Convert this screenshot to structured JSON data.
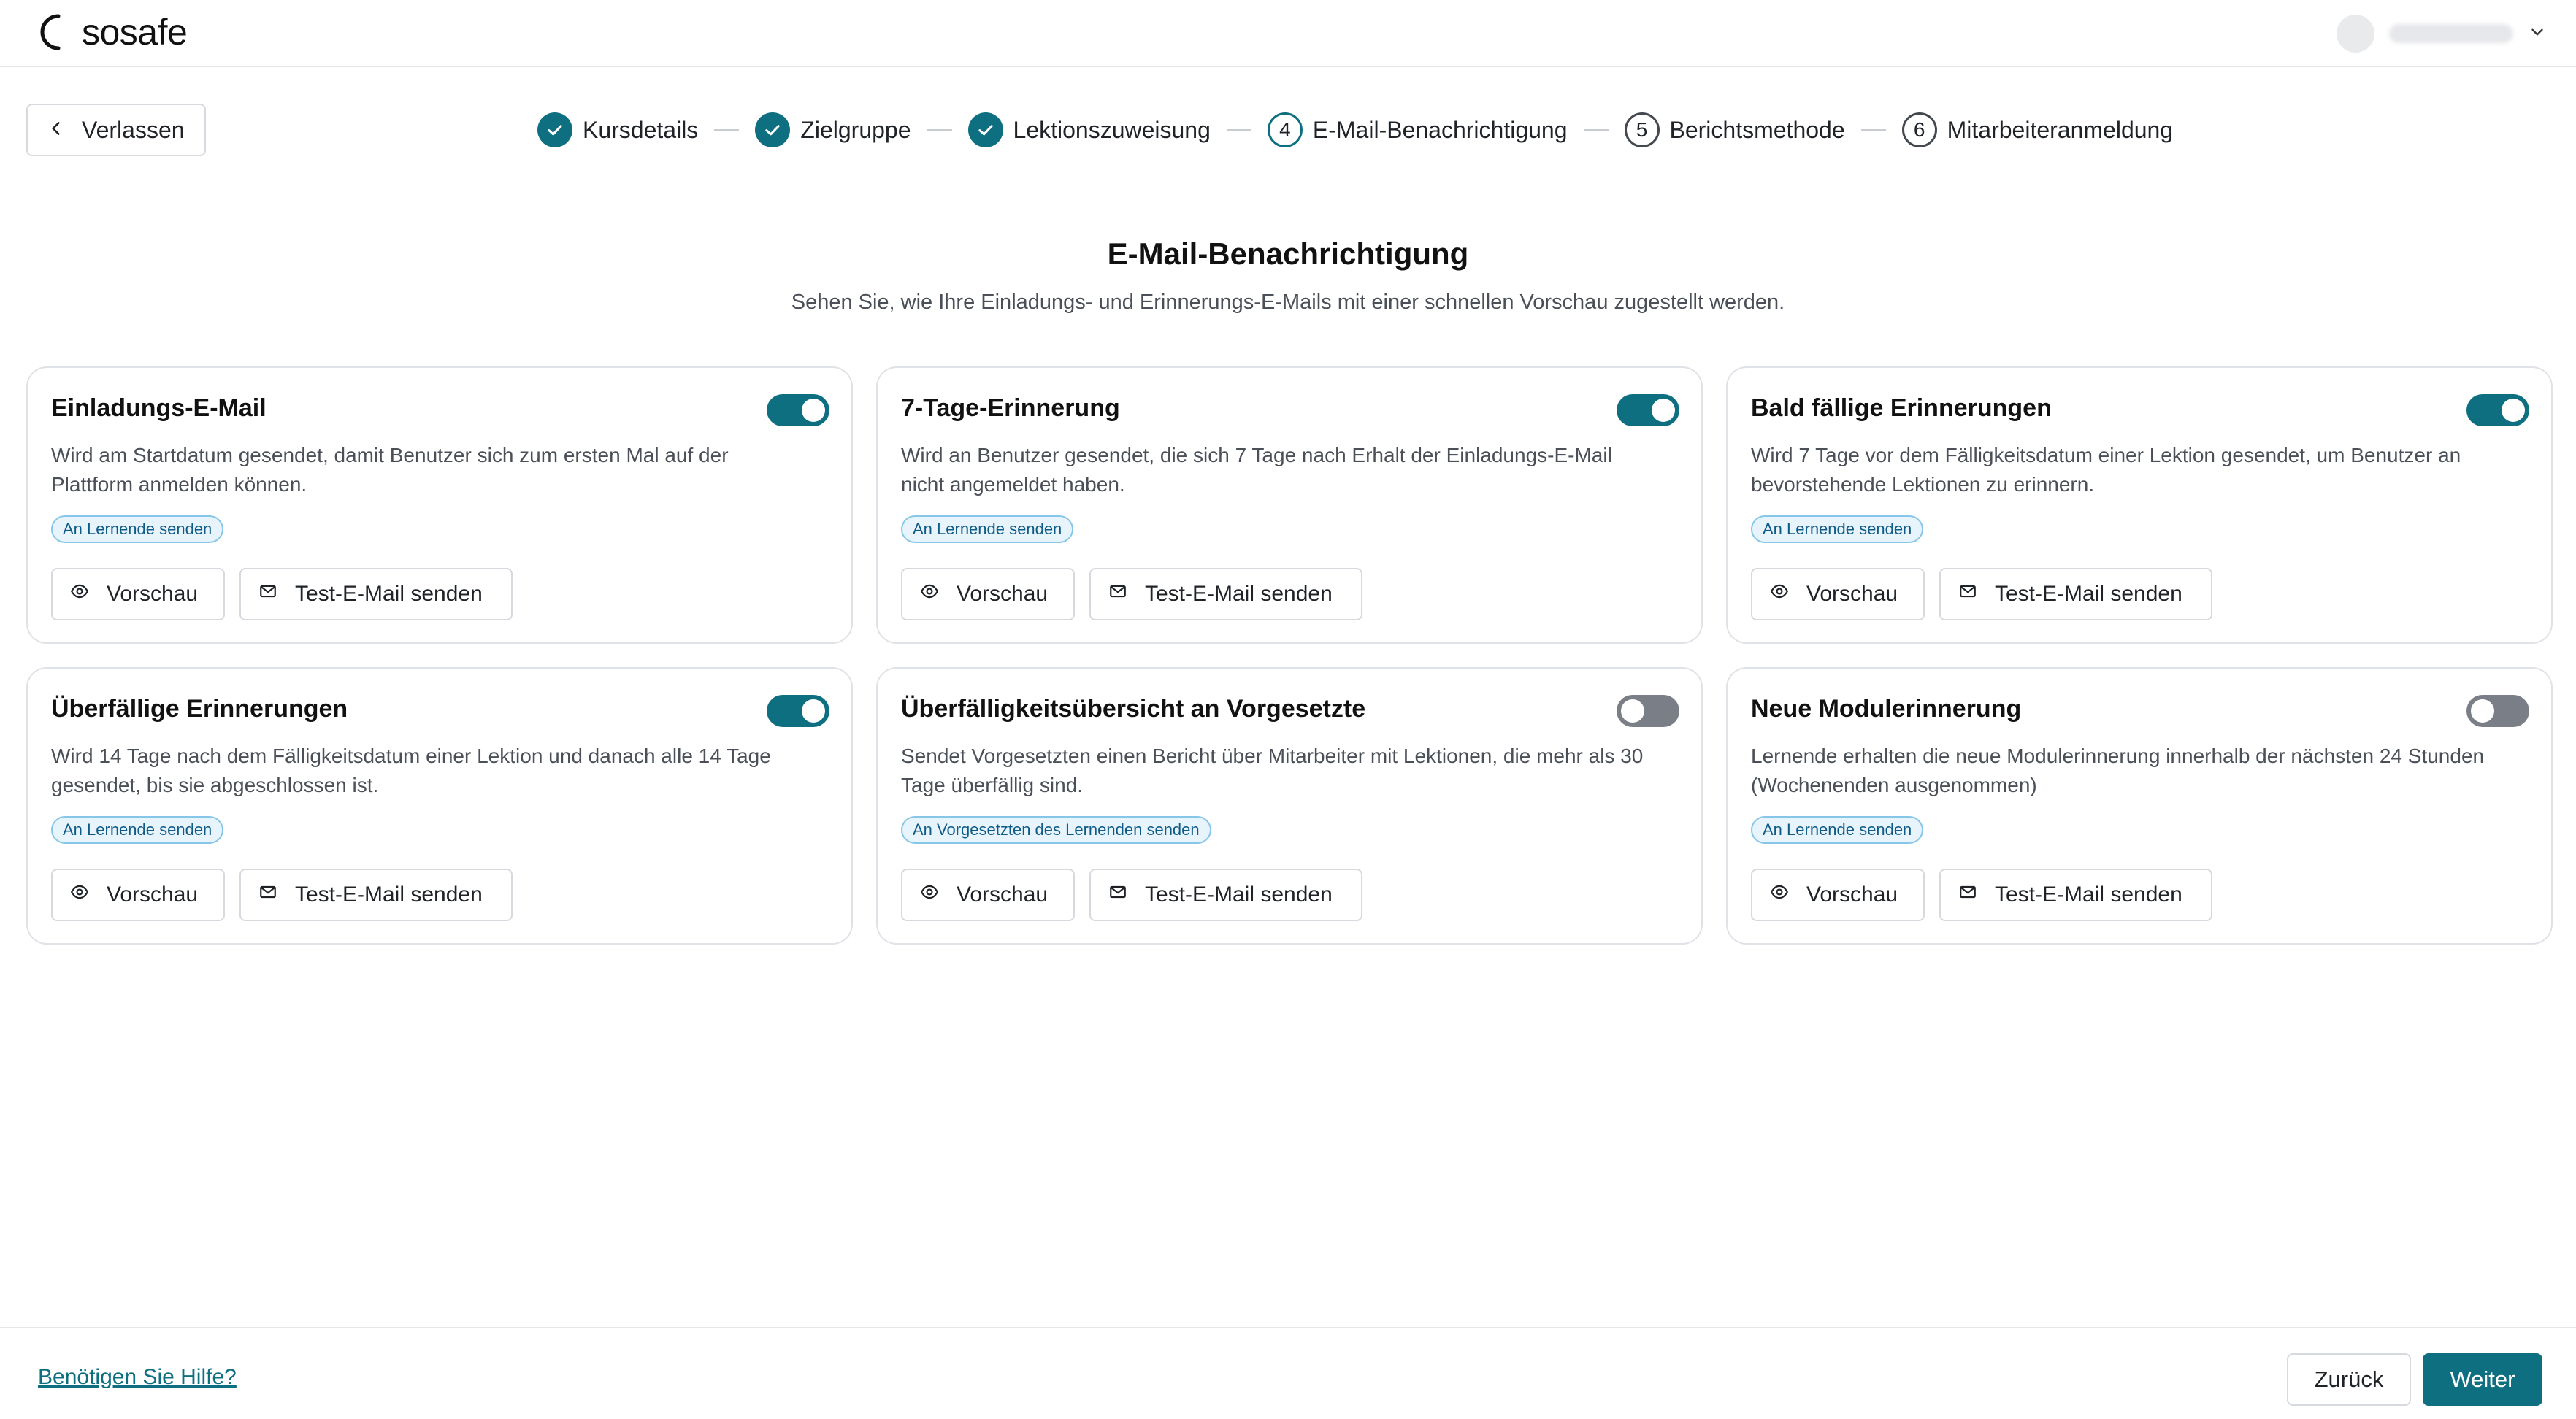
{
  "brand": {
    "name": "sosafe",
    "accent": "#0e6f80"
  },
  "header": {
    "user_menu_icon": "chevron-down-icon"
  },
  "nav": {
    "leave_label": "Verlassen"
  },
  "stepper": {
    "steps": [
      {
        "number": "1",
        "label": "Kursdetails",
        "status": "done"
      },
      {
        "number": "2",
        "label": "Zielgruppe",
        "status": "done"
      },
      {
        "number": "3",
        "label": "Lektionszuweisung",
        "status": "done"
      },
      {
        "number": "4",
        "label": "E-Mail-Benachrichtigung",
        "status": "current"
      },
      {
        "number": "5",
        "label": "Berichtsmethode",
        "status": "todo"
      },
      {
        "number": "6",
        "label": "Mitarbeiteranmeldung",
        "status": "todo"
      }
    ]
  },
  "page": {
    "title": "E-Mail-Benachrichtigung",
    "subtitle": "Sehen Sie, wie Ihre Einladungs- und Erinnerungs-E-Mails mit einer schnellen Vorschau zugestellt werden."
  },
  "buttons": {
    "preview": "Vorschau",
    "test": "Test-E-Mail senden"
  },
  "cards": [
    {
      "title": "Einladungs-E-Mail",
      "enabled": true,
      "description": "Wird am Startdatum gesendet, damit Benutzer sich zum ersten Mal auf der Plattform anmelden können.",
      "badge": "An Lernende senden"
    },
    {
      "title": "7-Tage-Erinnerung",
      "enabled": true,
      "description": "Wird an Benutzer gesendet, die sich 7 Tage nach Erhalt der Einladungs-E-Mail nicht angemeldet haben.",
      "badge": "An Lernende senden"
    },
    {
      "title": "Bald fällige Erinnerungen",
      "enabled": true,
      "description": "Wird 7 Tage vor dem Fälligkeitsdatum einer Lektion gesendet, um Benutzer an bevorstehende Lektionen zu erinnern.",
      "badge": "An Lernende senden"
    },
    {
      "title": "Überfällige Erinnerungen",
      "enabled": true,
      "description": "Wird 14 Tage nach dem Fälligkeitsdatum einer Lektion und danach alle 14 Tage gesendet, bis sie abgeschlossen ist.",
      "badge": "An Lernende senden"
    },
    {
      "title": "Überfälligkeitsübersicht an Vorgesetzte",
      "enabled": false,
      "description": "Sendet Vorgesetzten einen Bericht über Mitarbeiter mit Lektionen, die mehr als 30 Tage überfällig sind.",
      "badge": "An Vorgesetzten des Lernenden senden"
    },
    {
      "title": "Neue Modulerinnerung",
      "enabled": false,
      "description": "Lernende erhalten die neue Modulerinnerung innerhalb der nächsten 24 Stunden (Wochenenden ausgenommen)",
      "badge": "An Lernende senden"
    }
  ],
  "footer": {
    "help_link": "Benötigen Sie Hilfe?",
    "back_label": "Zurück",
    "next_label": "Weiter"
  }
}
